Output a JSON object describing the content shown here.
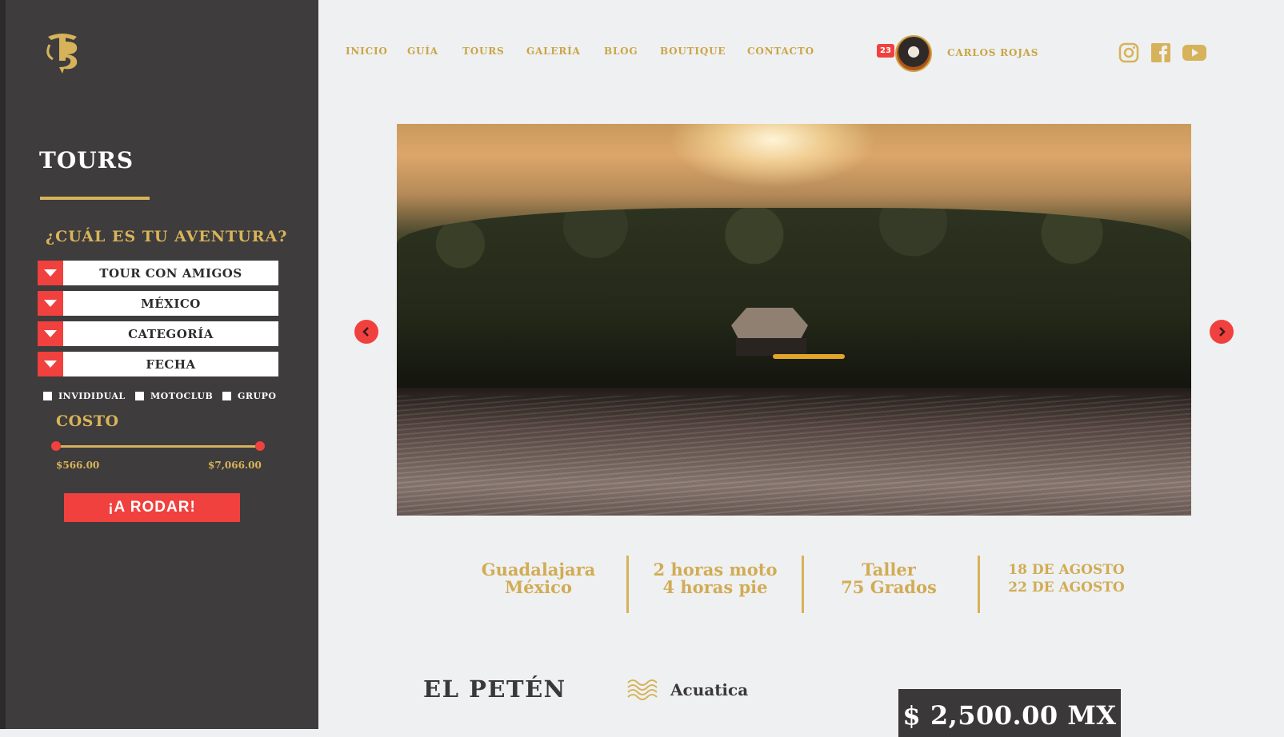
{
  "logo": {
    "alt": "TB"
  },
  "sidebar": {
    "title": "TOURS",
    "question": "¿CUÁL ES TU AVENTURA?",
    "filters": [
      "TOUR CON AMIGOS",
      "MÉXICO",
      "CATEGORÍA",
      "FECHA"
    ],
    "checkboxes": [
      "INVIDIDUAL",
      "MOTOCLUB",
      "GRUPO"
    ],
    "cost_label": "COSTO",
    "price_min": "$566.00",
    "price_max": "$7,066.00",
    "submit_label": "¡A RODAR!"
  },
  "nav": {
    "items": [
      "INICIO",
      "GUÍA",
      "TOURS",
      "GALERÍA",
      "BLOG",
      "BOUTIQUE",
      "CONTACTO"
    ],
    "notifications": "23",
    "user_name": "CARLOS ROJAS",
    "social_icons": [
      "instagram-icon",
      "facebook-icon",
      "youtube-icon"
    ]
  },
  "info": {
    "location": [
      "Guadalajara",
      "México"
    ],
    "duration": [
      "2 horas moto",
      "4 horas pie"
    ],
    "venue": [
      "Taller",
      "75 Grados"
    ],
    "dates": [
      "18 DE AGOSTO",
      "22 DE AGOSTO"
    ]
  },
  "tour": {
    "name": "EL PETÉN",
    "category": "Acuatica",
    "price": "$ 2,500.00 MX"
  },
  "colors": {
    "accent": "#f0413e",
    "gold": "#d6b35a",
    "sidebar": "#3e3c3d",
    "background": "#eff0f1"
  }
}
